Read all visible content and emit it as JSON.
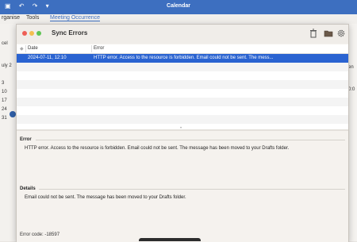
{
  "background": {
    "title": "Calendar",
    "tabs": [
      "rganise",
      "Tools",
      "Meeting Occurrence"
    ],
    "left_fragments": [
      "cel",
      "uly 2",
      "3",
      "10",
      "17",
      "24",
      "31"
    ],
    "right_fragments": [
      "en",
      "0:0"
    ]
  },
  "dialog": {
    "title": "Sync Errors",
    "table": {
      "columns": [
        "Date",
        "Error"
      ],
      "rows": [
        {
          "date": "2024-07-11, 12:10",
          "error": "HTTP error. Access to the resource is forbidden. Email could not be sent. The mess..."
        }
      ]
    },
    "error_section": {
      "title": "Error",
      "text": "HTTP error. Access to the resource is forbidden. Email could not be sent. The message has been moved to your Drafts folder."
    },
    "details_section": {
      "title": "Details",
      "text": "Email could not be sent. The message has been moved to your Drafts folder."
    },
    "error_code": "Error code: -18597"
  },
  "icons": [
    "trash-icon",
    "folder-icon",
    "gear-icon"
  ],
  "colors": {
    "accent": "#2a63d1",
    "titlebar": "#3d6fc0"
  }
}
